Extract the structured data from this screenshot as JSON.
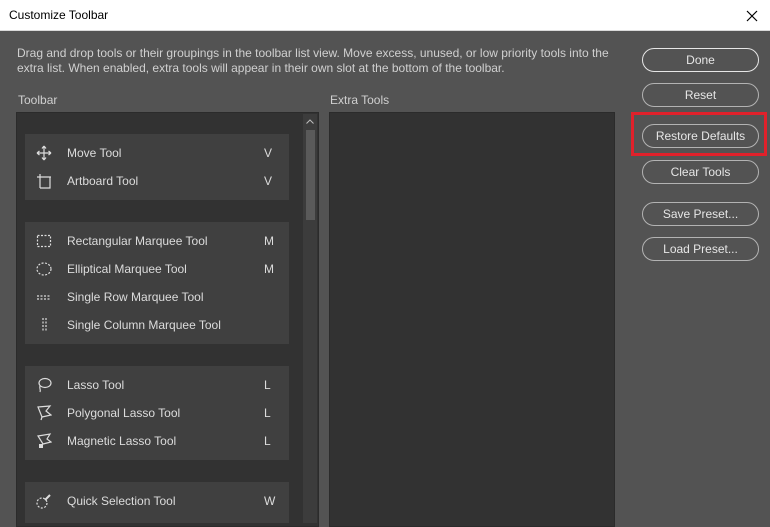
{
  "window": {
    "title": "Customize Toolbar"
  },
  "description": "Drag and drop tools or their groupings in the toolbar list view. Move excess, unused, or low priority tools into the extra list. When enabled, extra tools will appear in their own slot at the bottom of the toolbar.",
  "toolbar": {
    "label": "Toolbar",
    "groups": [
      {
        "tools": [
          {
            "name": "Move Tool",
            "key": "V",
            "icon": "move-icon"
          },
          {
            "name": "Artboard Tool",
            "key": "V",
            "icon": "artboard-icon"
          }
        ]
      },
      {
        "tools": [
          {
            "name": "Rectangular Marquee Tool",
            "key": "M",
            "icon": "rectangular-marquee-icon"
          },
          {
            "name": "Elliptical Marquee Tool",
            "key": "M",
            "icon": "elliptical-marquee-icon"
          },
          {
            "name": "Single Row Marquee Tool",
            "key": "",
            "icon": "single-row-marquee-icon"
          },
          {
            "name": "Single Column Marquee Tool",
            "key": "",
            "icon": "single-column-marquee-icon"
          }
        ]
      },
      {
        "tools": [
          {
            "name": "Lasso Tool",
            "key": "L",
            "icon": "lasso-icon"
          },
          {
            "name": "Polygonal Lasso Tool",
            "key": "L",
            "icon": "polygonal-lasso-icon"
          },
          {
            "name": "Magnetic Lasso Tool",
            "key": "L",
            "icon": "magnetic-lasso-icon"
          }
        ]
      },
      {
        "tools": [
          {
            "name": "Quick Selection Tool",
            "key": "W",
            "icon": "quick-selection-icon"
          }
        ]
      }
    ]
  },
  "extra_tools": {
    "label": "Extra Tools"
  },
  "buttons": {
    "done": "Done",
    "reset": "Reset",
    "restore_defaults": "Restore Defaults",
    "clear_tools": "Clear Tools",
    "save_preset": "Save Preset...",
    "load_preset": "Load Preset..."
  },
  "colors": {
    "highlight": "#e0212b",
    "dialog_bg": "#535353",
    "panel_bg": "#323232",
    "group_bg": "#404040"
  }
}
